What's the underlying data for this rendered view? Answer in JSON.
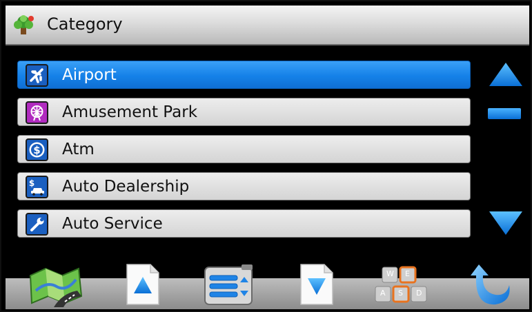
{
  "header": {
    "title": "Category",
    "logo_icon": "category-tree-icon"
  },
  "list": {
    "items": [
      {
        "label": "Airport",
        "icon": "airplane-icon",
        "selected": true
      },
      {
        "label": "Amusement Park",
        "icon": "ferris-wheel-icon",
        "selected": false
      },
      {
        "label": "Atm",
        "icon": "dollar-coin-icon",
        "selected": false
      },
      {
        "label": "Auto Dealership",
        "icon": "car-dealer-icon",
        "selected": false
      },
      {
        "label": "Auto Service",
        "icon": "wrench-icon",
        "selected": false
      }
    ]
  },
  "toolbar": {
    "buttons": [
      {
        "icon": "map-icon"
      },
      {
        "icon": "page-up-icon"
      },
      {
        "icon": "list-view-icon"
      },
      {
        "icon": "page-down-icon"
      },
      {
        "icon": "keyboard-icon",
        "keys": [
          "W",
          "E",
          "A",
          "S",
          "D"
        ]
      },
      {
        "icon": "back-arrow-icon"
      }
    ]
  },
  "colors": {
    "selected": "#1581e8",
    "accent_blue": "#1a86ef",
    "row": "#d9d9d9",
    "background": "#000000"
  }
}
